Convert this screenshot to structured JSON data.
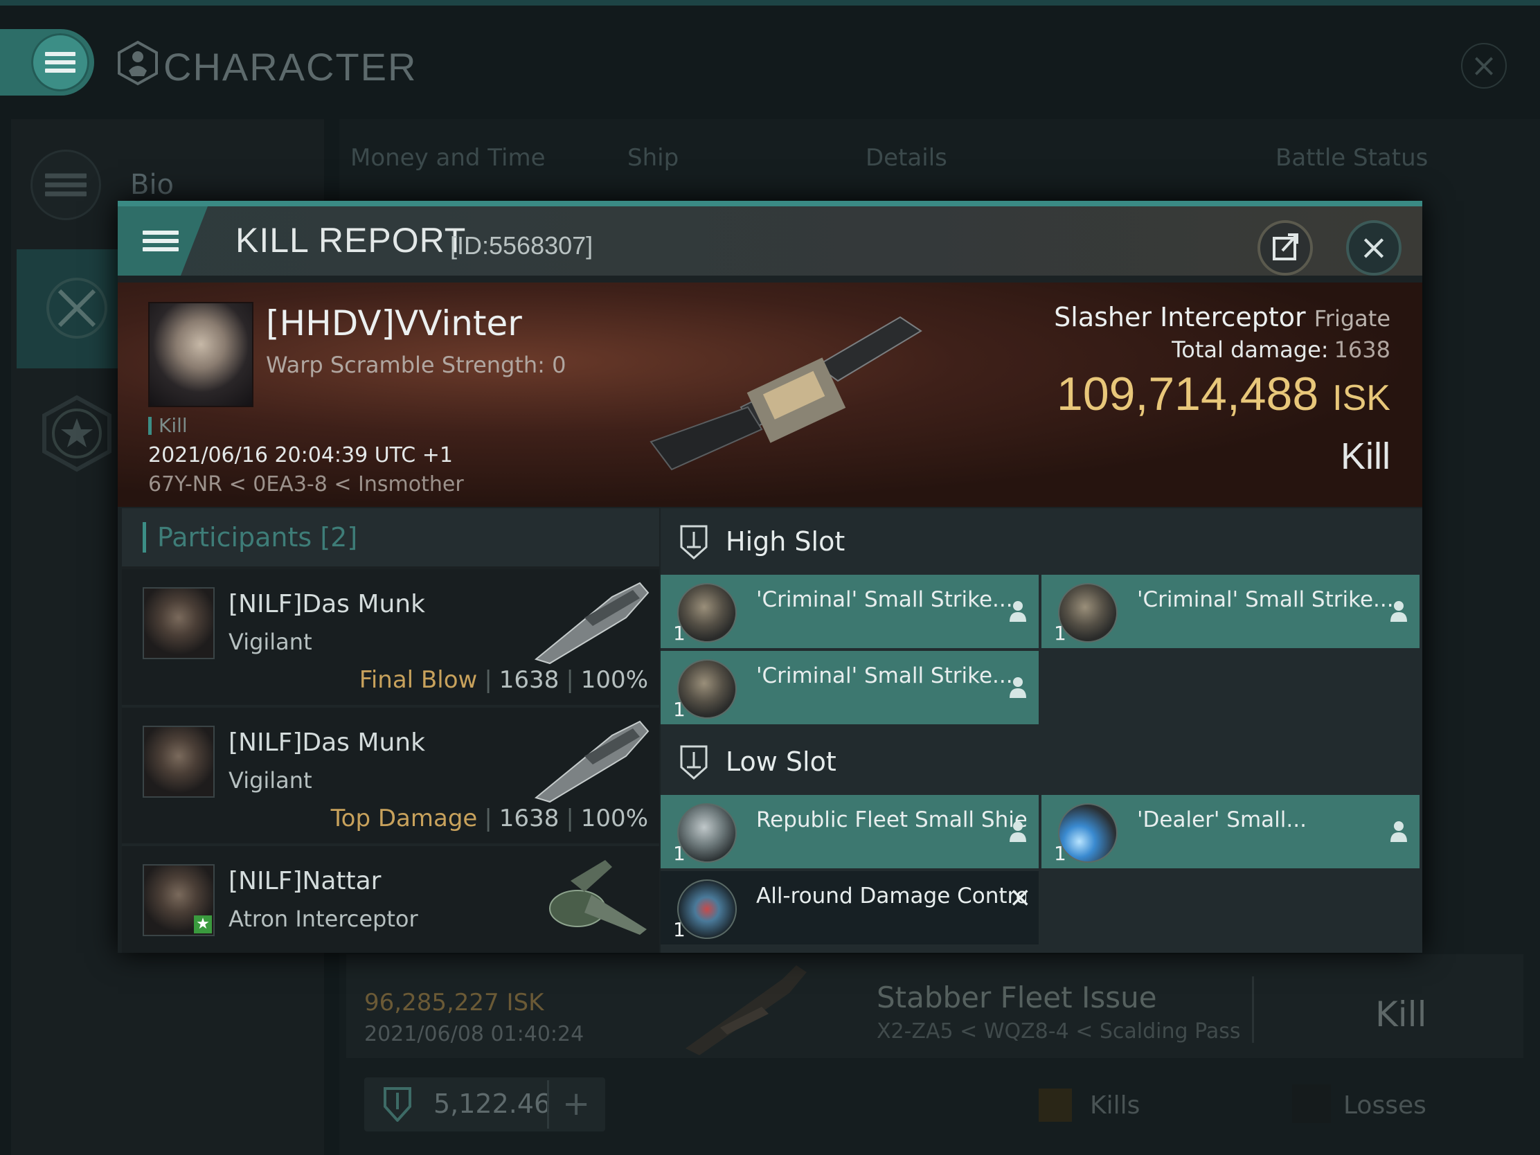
{
  "app": {
    "window_title": "CHARACTER",
    "sidebar": {
      "bio_label": "Bio"
    },
    "tabs": [
      "Money and Time",
      "Ship",
      "Details",
      "Battle Status"
    ],
    "background_row": {
      "isk": "96,285,227  ISK",
      "date": "2021/06/08  01:40:24",
      "ship": "Stabber Fleet Issue",
      "route": "X2-ZA5 < WQZ8-4 < Scalding Pass",
      "result": "Kill"
    },
    "footer": {
      "wallet": "5,122.46",
      "kills_label": "Kills",
      "losses_label": "Losses"
    }
  },
  "report": {
    "title": "KILL REPORT",
    "id": "[ID:5568307]",
    "victim": {
      "name": "[HHDV]VVinter",
      "warp": "Warp Scramble Strength: 0",
      "badge": "Kill",
      "time": "2021/06/16 20:04:39 UTC +1",
      "route": "67Y-NR < 0EA3-8 < Insmother"
    },
    "ship": {
      "name": "Slasher Interceptor",
      "class": "Frigate",
      "damage_label": "Total damage:",
      "damage_value": "1638",
      "isk_value": "109,714,488",
      "isk_unit": "ISK",
      "result": "Kill"
    },
    "participants": {
      "title": "Participants",
      "count": "[2]",
      "rows": [
        {
          "name": "[NILF]Das Munk",
          "ship": "Vigilant",
          "tag": "Final Blow",
          "damage": "1638",
          "percent": "100%"
        },
        {
          "name": "[NILF]Das Munk",
          "ship": "Vigilant",
          "tag": "Top Damage",
          "damage": "1638",
          "percent": "100%"
        },
        {
          "name": "[NILF]Nattar",
          "ship": "Atron Interceptor"
        }
      ]
    },
    "fittings": {
      "high_slot_title": "High Slot",
      "low_slot_title": "Low Slot",
      "high": [
        {
          "name": "'Criminal' Small Strike...",
          "qty": "1",
          "icon": "blaster-turret-icon"
        },
        {
          "name": "'Criminal' Small Strike...",
          "qty": "1",
          "icon": "blaster-turret-icon"
        },
        {
          "name": "'Criminal' Small Strike...",
          "qty": "1",
          "icon": "blaster-turret-icon"
        }
      ],
      "low": [
        {
          "name": "Republic Fleet Small Shield...",
          "qty": "1",
          "icon": "shield-module-icon"
        },
        {
          "name": "'Dealer' Small...",
          "qty": "1",
          "icon": "thruster-module-icon"
        },
        {
          "name": "All-round Damage Control",
          "qty": "1",
          "icon": "damage-control-icon"
        }
      ]
    }
  },
  "colors": {
    "accent": "#3c8e86",
    "dropped_module": "#3d7870",
    "destroyed_module": "#172024",
    "isk_gold": "#e8c77a",
    "banner": "#3e2019"
  }
}
